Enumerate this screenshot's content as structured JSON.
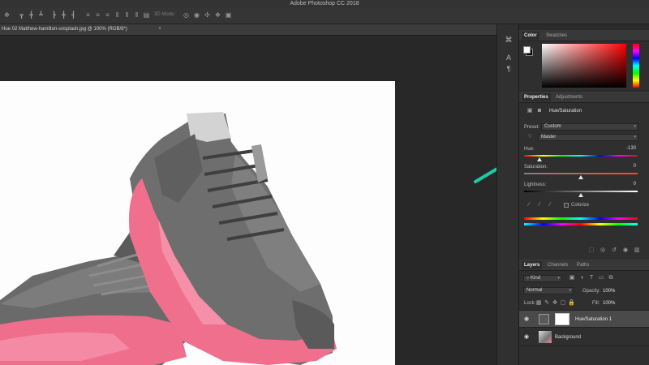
{
  "app": {
    "title": "Adobe Photoshop CC 2018"
  },
  "options_bar": {
    "mode_3d_label": "3D Mode:",
    "icons": [
      "move-icon",
      "align-top-icon",
      "align-vcenter-icon",
      "align-bottom-icon",
      "align-left-icon",
      "align-hcenter-icon",
      "align-right-icon",
      "distribute-top-icon",
      "distribute-vcenter-icon",
      "distribute-bottom-icon",
      "distribute-left-icon",
      "distribute-hcenter-icon",
      "distribute-right-icon",
      "auto-align-icon"
    ]
  },
  "document": {
    "tab_label": "Hue 02 Matthew-hamilton-unsplash.jpg @ 100% (RGB/8*)",
    "close_glyph": "×"
  },
  "tool_strip": {
    "icons": [
      "history-brush-icon",
      "character-icon",
      "paragraph-icon"
    ]
  },
  "color_panel": {
    "tabs": [
      "Color",
      "Swatches"
    ],
    "foreground": "#ffffff",
    "background": "#000000",
    "picker_hue": "#ff0000"
  },
  "properties_panel": {
    "tabs": [
      "Properties",
      "Adjustments"
    ],
    "title": "Hue/Saturation",
    "preset_label": "Preset:",
    "preset_value": "Custom",
    "channel_value": "Master",
    "hue_label": "Hue:",
    "hue_value": "-130",
    "hue_level": -130,
    "saturation_label": "Saturation:",
    "saturation_value": "0",
    "lightness_label": "Lightness:",
    "lightness_value": "0",
    "colorize_label": "Colorize"
  },
  "layers_panel": {
    "tabs": [
      "Layers",
      "Channels",
      "Paths"
    ],
    "filter_label": "Kind",
    "blend_mode": "Normal",
    "opacity_label": "Opacity:",
    "opacity_value": "100%",
    "lock_label": "Lock:",
    "fill_label": "Fill:",
    "fill_value": "100%",
    "layers": [
      {
        "name": "Hue/Saturation 1",
        "selected": true
      },
      {
        "name": "Background",
        "selected": false
      }
    ]
  },
  "annotation": {
    "arrow_color": "#1fc9a4"
  },
  "colors": {
    "shoe_pink": "#f0708e",
    "shoe_grey": "#6b6b6b"
  }
}
